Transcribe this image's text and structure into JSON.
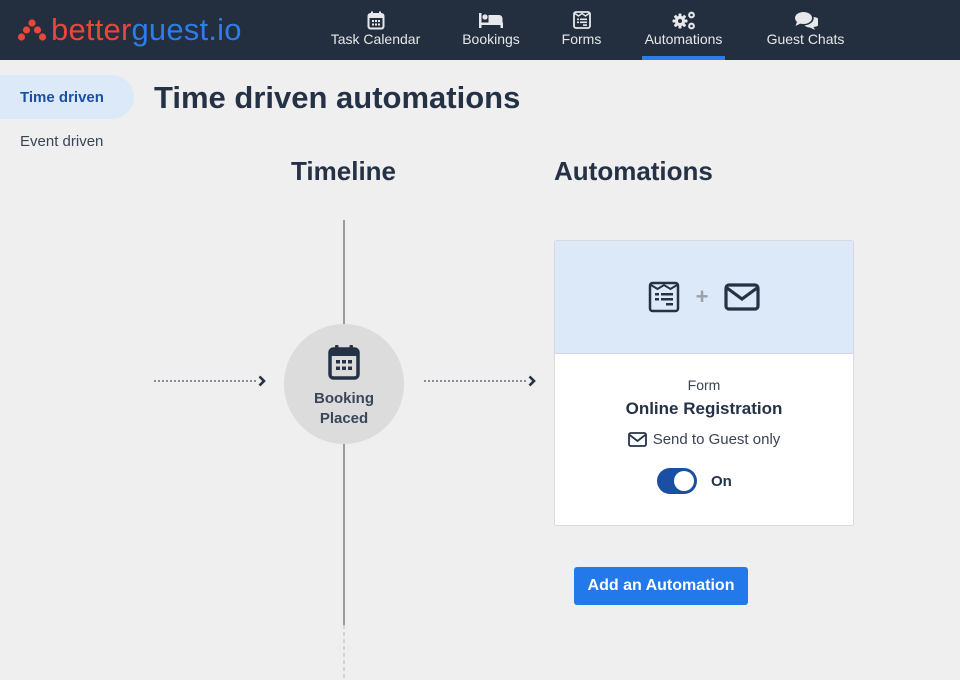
{
  "app": {
    "logo_part1": "better",
    "logo_part2": "guest.io",
    "brand_red": "#e8473a",
    "brand_blue": "#2b7de9"
  },
  "nav": {
    "items": [
      {
        "label": "Task Calendar",
        "icon": "calendar-icon",
        "active": false
      },
      {
        "label": "Bookings",
        "icon": "bed-icon",
        "active": false
      },
      {
        "label": "Forms",
        "icon": "form-icon",
        "active": false
      },
      {
        "label": "Automations",
        "icon": "gears-icon",
        "active": true
      },
      {
        "label": "Guest Chats",
        "icon": "chat-bubbles-icon",
        "active": false
      }
    ]
  },
  "sidebar": {
    "items": [
      {
        "label": "Time driven",
        "active": true
      },
      {
        "label": "Event driven",
        "active": false
      }
    ]
  },
  "page": {
    "title": "Time driven automations",
    "timeline_heading": "Timeline",
    "automations_heading": "Automations"
  },
  "timeline": {
    "node": {
      "icon": "calendar-icon",
      "line1": "Booking",
      "line2": "Placed"
    }
  },
  "automation_card": {
    "icons": [
      "form-icon",
      "plus",
      "envelope-icon"
    ],
    "plus": "+",
    "type": "Form",
    "name": "Online Registration",
    "recipient": "Send to Guest only",
    "toggle_on": true,
    "toggle_label": "On"
  },
  "actions": {
    "add_label": "Add an Automation"
  }
}
